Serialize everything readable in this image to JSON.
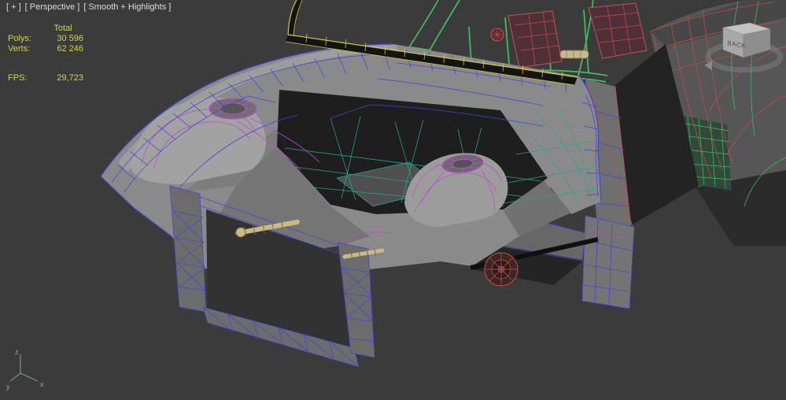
{
  "viewport": {
    "menu_general": "[ + ]",
    "menu_pov": "[ Perspective ]",
    "menu_shading": "[ Smooth + Highlights ]"
  },
  "stats": {
    "total_label": "Total",
    "rows": [
      {
        "label": "Polys:",
        "value": "30 596"
      },
      {
        "label": "Verts:",
        "value": "62 246"
      }
    ],
    "fps_label": "FPS:",
    "fps_value": "29,723"
  },
  "viewcube": {
    "face_label": "BACK"
  },
  "axis_gizmo": {
    "x": "x",
    "y": "y",
    "z": "z"
  },
  "colors": {
    "background": "#3b3b3b",
    "stats_text": "#d6d24a",
    "label_text": "#dcdcdc",
    "wire_blue": "#4343d8",
    "wire_purple": "#bb4ecc",
    "wire_teal": "#2aa391",
    "wire_green": "#3fbf5f",
    "wire_red": "#c34b4b",
    "wire_yellow": "#d8d22a",
    "body_gray": "#8a8a8a"
  }
}
